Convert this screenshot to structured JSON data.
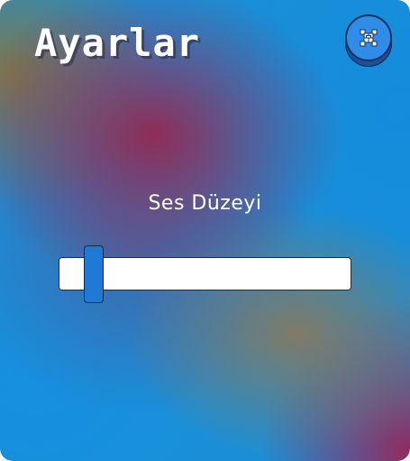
{
  "settings": {
    "title": "Ayarlar",
    "close_icon": "close-icon",
    "volume": {
      "label": "Ses Düzeyi",
      "level": 0.05
    }
  },
  "colors": {
    "close_button": "#2f8de8",
    "slider_thumb": "#2079d6",
    "slider_track": "#ffffff"
  }
}
